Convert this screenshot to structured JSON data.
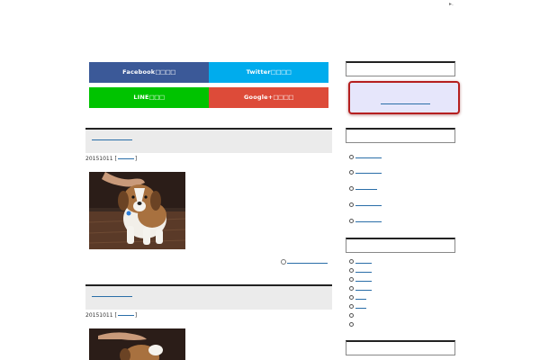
{
  "share": {
    "facebook": {
      "label": "Facebook",
      "glyphs": "□□□□",
      "color": "#3b5998"
    },
    "twitter": {
      "label": "Twitter",
      "glyphs": "□□□□",
      "color": "#00aced"
    },
    "line": {
      "label": "LINE",
      "glyphs": "□□□",
      "color": "#00c300"
    },
    "google": {
      "label": "Google+",
      "glyphs": "□□□□",
      "color": "#dd4b39"
    }
  },
  "posts": [
    {
      "date": "20151011",
      "open_bracket": "[",
      "close_bracket": "]"
    },
    {
      "date": "20151011",
      "open_bracket": "[",
      "close_bracket": "]"
    }
  ],
  "corner_mark": "▸."
}
